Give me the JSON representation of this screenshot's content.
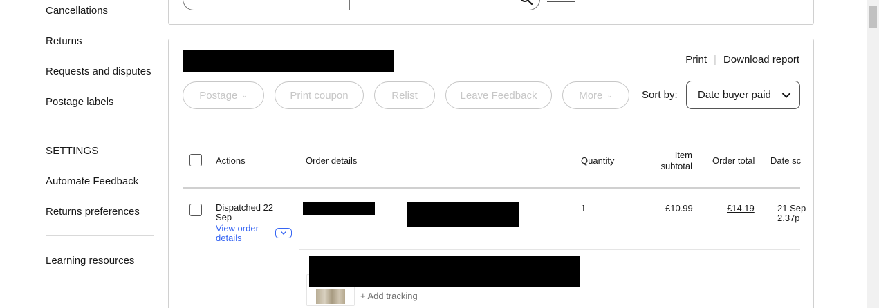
{
  "sidebar": {
    "items_top": [
      {
        "label": "Cancellations"
      },
      {
        "label": "Returns"
      },
      {
        "label": "Requests and disputes"
      },
      {
        "label": "Postage labels"
      }
    ],
    "settings_heading": "SETTINGS",
    "items_settings": [
      {
        "label": "Automate Feedback"
      },
      {
        "label": "Returns preferences"
      }
    ],
    "learning": {
      "label": "Learning resources"
    }
  },
  "header_links": {
    "print": "Print",
    "separator": "|",
    "download": "Download report"
  },
  "actions": {
    "postage": "Postage",
    "print_coupon": "Print coupon",
    "relist": "Relist",
    "leave_feedback": "Leave Feedback",
    "more": "More"
  },
  "sort": {
    "label": "Sort by:",
    "selected": "Date buyer paid"
  },
  "table": {
    "columns": {
      "actions": "Actions",
      "order_details": "Order details",
      "quantity": "Quantity",
      "item_subtotal": "Item subtotal",
      "order_total": "Order total",
      "date_sold": "Date sc"
    },
    "rows": [
      {
        "status": "Dispatched 22 Sep",
        "view_link": "View order details",
        "quantity": "1",
        "item_subtotal": "£10.99",
        "order_total": "£14.19",
        "date_sold_line1": "21 Sep",
        "date_sold_line2": "2.37p",
        "add_tracking": "+ Add tracking"
      }
    ]
  },
  "colors": {
    "link_blue": "#3665f3",
    "disabled_grey": "#c7c7c7",
    "border": "#d0d0d0"
  },
  "icons": [
    "search-icon",
    "chevron-down-icon",
    "expand-chevron-icon",
    "checkbox-icon"
  ]
}
